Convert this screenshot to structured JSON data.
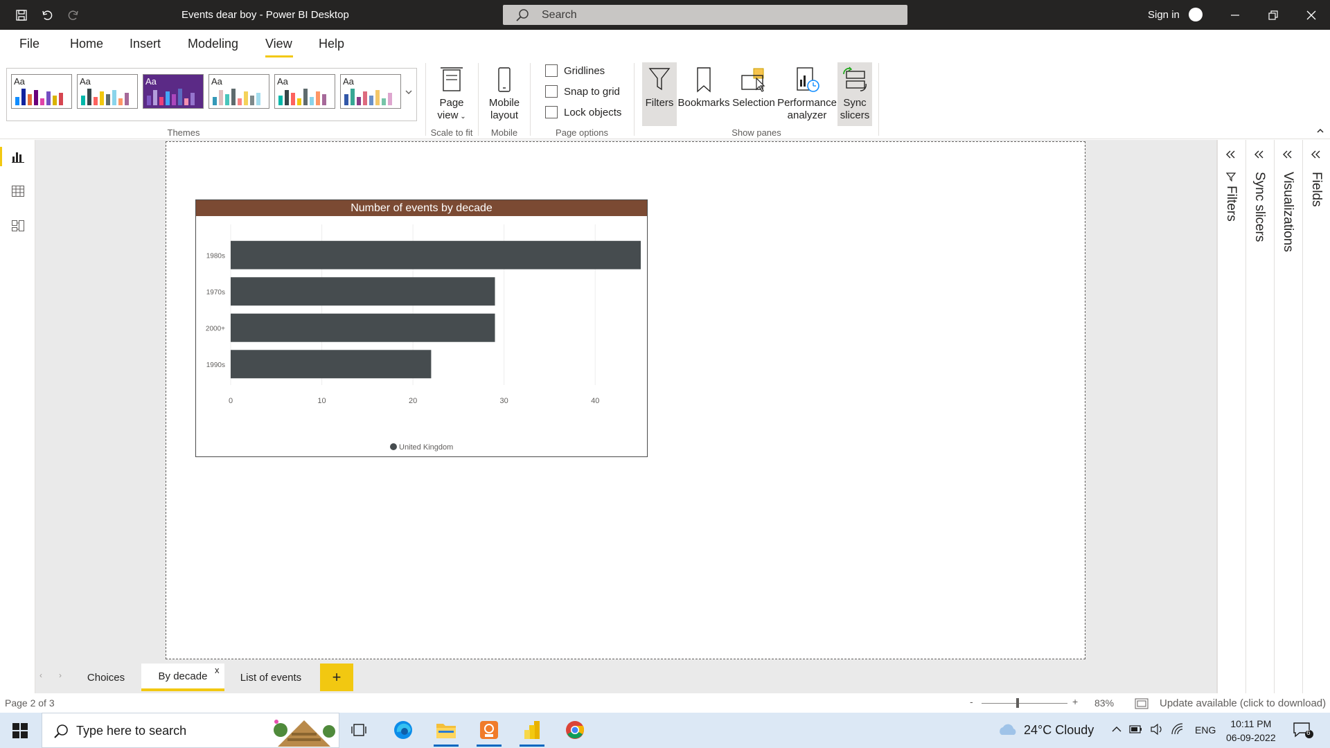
{
  "titlebar": {
    "title": "Events dear boy - Power BI Desktop",
    "search_placeholder": "Search",
    "sign_in": "Sign in"
  },
  "menu": {
    "items": [
      "File",
      "Home",
      "Insert",
      "Modeling",
      "View",
      "Help"
    ],
    "active": "View"
  },
  "ribbon": {
    "groups": {
      "themes": "Themes",
      "scale_to_fit": "Scale to fit",
      "mobile": "Mobile",
      "page_options": "Page options",
      "show_panes": "Show panes"
    },
    "page_view": {
      "line1": "Page",
      "line2": "view"
    },
    "mobile_layout": {
      "line1": "Mobile",
      "line2": "layout"
    },
    "checkboxes": [
      "Gridlines",
      "Snap to grid",
      "Lock objects"
    ],
    "panes": {
      "filters": "Filters",
      "bookmarks": "Bookmarks",
      "selection": "Selection",
      "performance": {
        "line1": "Performance",
        "line2": "analyzer"
      },
      "sync": {
        "line1": "Sync",
        "line2": "slicers"
      }
    },
    "theme_swatch_label": "Aa"
  },
  "colors": {
    "accent": "#f2c811",
    "chart_header": "#7b4a33",
    "bar": "#464c4f",
    "titlebar": "#252423"
  },
  "chart_data": {
    "type": "bar",
    "orientation": "horizontal",
    "title": "Number of events by decade",
    "categories": [
      "1980s",
      "1970s",
      "2000+",
      "1990s"
    ],
    "series": [
      {
        "name": "United Kingdom",
        "values": [
          45,
          29,
          29,
          22
        ]
      }
    ],
    "xlim": [
      0,
      45
    ],
    "xticks": [
      0,
      10,
      20,
      30,
      40
    ],
    "grid": true,
    "legend": "bottom"
  },
  "right_panes": [
    "Filters",
    "Sync slicers",
    "Visualizations",
    "Fields"
  ],
  "page_tabs": {
    "tabs": [
      "Choices",
      "By decade",
      "List of events"
    ],
    "active": "By decade",
    "close": "x",
    "add": "+"
  },
  "statusbar": {
    "page_count": "Page 2 of 3",
    "zoom_level": "83%",
    "zoom_fraction": 0.42,
    "update": "Update available (click to download)",
    "zoom_minus": "-",
    "zoom_plus": "+"
  },
  "taskbar": {
    "search_placeholder": "Type here to search",
    "weather": "24°C  Cloudy",
    "language": "ENG",
    "time": "10:11 PM",
    "date": "06-09-2022",
    "notifications": "6"
  }
}
